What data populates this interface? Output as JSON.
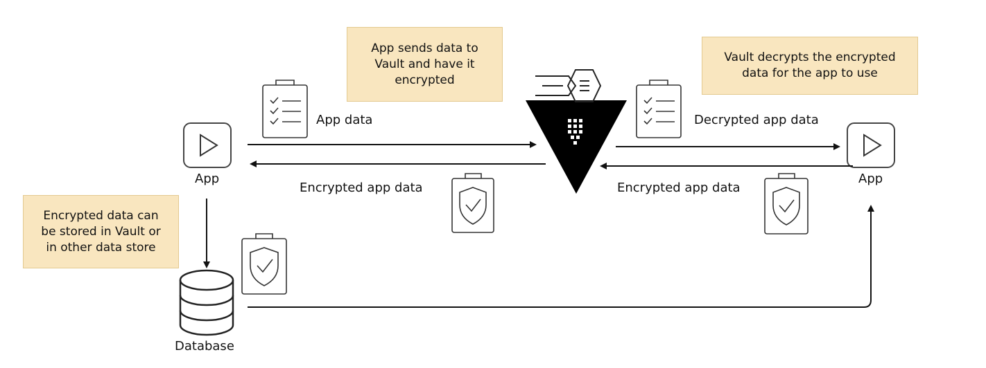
{
  "notes": {
    "encrypt": "App sends data to\nVault and have it\nencrypted",
    "decrypt": "Vault decrypts the encrypted\ndata for the app to use",
    "store": "Encrypted data can\nbe stored in Vault or\nin other data store"
  },
  "labels": {
    "app_left": "App",
    "app_right": "App",
    "database": "Database",
    "app_data": "App data",
    "encrypted_left": "Encrypted app data",
    "decrypted": "Decrypted app data",
    "encrypted_right": "Encrypted app data"
  },
  "icons": [
    "key-icon",
    "vault-logo-icon",
    "app-play-icon",
    "clipboard-checklist-icon",
    "clipboard-shield-icon",
    "database-icon"
  ],
  "colors": {
    "note_fill": "#f9e6bf",
    "stroke": "#222222",
    "vault": "#000000"
  }
}
